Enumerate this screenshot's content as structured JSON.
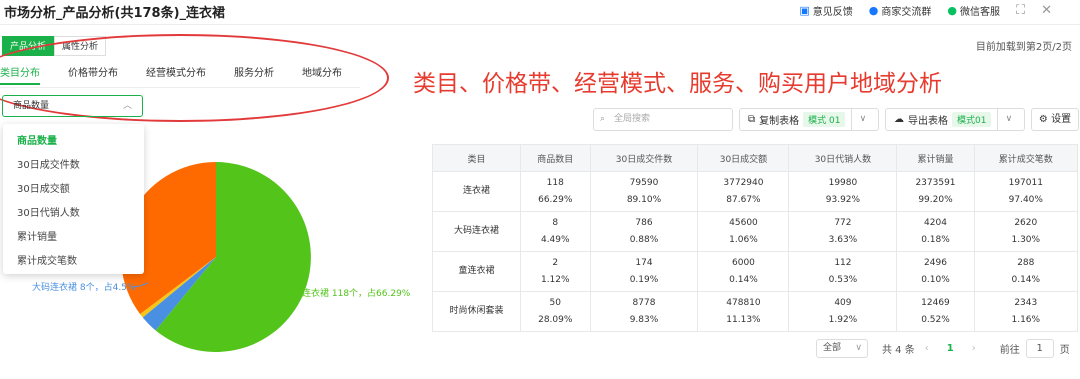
{
  "header": {
    "title": "市场分析_产品分析(共178条)_连衣裙",
    "links": [
      {
        "label": "意见反馈",
        "icon": "feedback-icon"
      },
      {
        "label": "商家交流群",
        "icon": "chat-group-icon"
      },
      {
        "label": "微信客服",
        "icon": "wechat-icon"
      }
    ],
    "expand_icon": "expand-icon",
    "close_icon": "close-icon"
  },
  "subtabs": [
    "产品分析",
    "属性分析"
  ],
  "loaded_text": "目前加载到第2页/2页",
  "tabs": [
    "类目分布",
    "价格带分布",
    "经营模式分布",
    "服务分析",
    "地域分布"
  ],
  "annotation": "类目、价格带、经营模式、服务、购买用户地域分析",
  "metric_select": {
    "value": "商品数量",
    "options": [
      "商品数量",
      "30日成交件数",
      "30日成交额",
      "30日代销人数",
      "累计销量",
      "累计成交笔数"
    ]
  },
  "pie": {
    "label_main": "连衣裙 118个，占66.29%",
    "label_second": "大码连衣裙 8个，占4.5%"
  },
  "toolbar": {
    "search_placeholder": "全局搜索",
    "copy_label": "复制表格",
    "copy_mode": "模式 01",
    "export_label": "导出表格",
    "export_mode": "模式01",
    "settings_label": "设置"
  },
  "table": {
    "headers": [
      "类目",
      "商品数目",
      "30日成交件数",
      "30日成交额",
      "30日代销人数",
      "累计销量",
      "累计成交笔数"
    ],
    "rows": [
      {
        "cat": "连衣裙",
        "c1": "118",
        "p1": "66.29%",
        "c2": "79590",
        "p2": "89.10%",
        "c3": "3772940",
        "p3": "87.67%",
        "c4": "19980",
        "p4": "93.92%",
        "c5": "2373591",
        "p5": "99.20%",
        "c6": "197011",
        "p6": "97.40%"
      },
      {
        "cat": "大码连衣裙",
        "c1": "8",
        "p1": "4.49%",
        "c2": "786",
        "p2": "0.88%",
        "c3": "45600",
        "p3": "1.06%",
        "c4": "772",
        "p4": "3.63%",
        "c5": "4204",
        "p5": "0.18%",
        "c6": "2620",
        "p6": "1.30%"
      },
      {
        "cat": "童连衣裙",
        "c1": "2",
        "p1": "1.12%",
        "c2": "174",
        "p2": "0.19%",
        "c3": "6000",
        "p3": "0.14%",
        "c4": "112",
        "p4": "0.53%",
        "c5": "2496",
        "p5": "0.10%",
        "c6": "288",
        "p6": "0.14%"
      },
      {
        "cat": "时尚休闲套装",
        "c1": "50",
        "p1": "28.09%",
        "c2": "8778",
        "p2": "9.83%",
        "c3": "478810",
        "p3": "11.13%",
        "c4": "409",
        "p4": "1.92%",
        "c5": "12469",
        "p5": "0.52%",
        "c6": "2343",
        "p6": "1.16%"
      }
    ]
  },
  "pager": {
    "select_value": "全部",
    "total": "共 4 条",
    "current_page": "1",
    "goto_label": "前往",
    "goto_value": "1",
    "page_unit": "页"
  },
  "colors": {
    "accent": "#1bb14a",
    "annotation": "#e63b2e",
    "pie_green": "#52c41a",
    "pie_orange": "#ff6a00",
    "pie_blue": "#4a90e2",
    "pie_yellow": "#f5c518"
  }
}
